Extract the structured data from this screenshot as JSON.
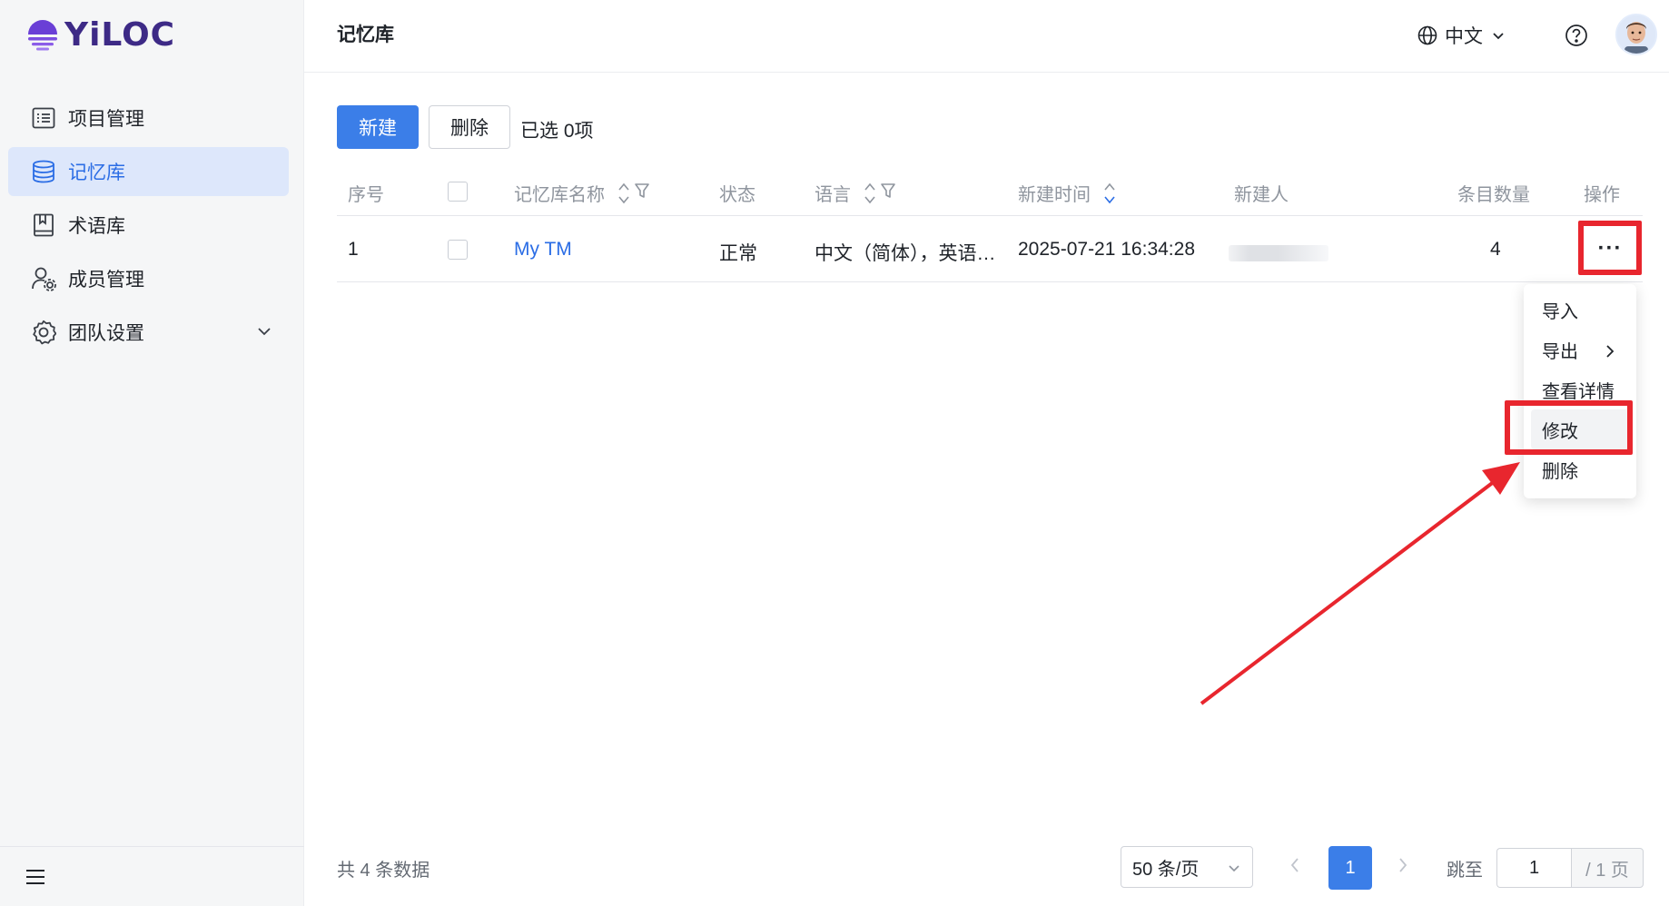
{
  "app": {
    "brand": "YiLOC"
  },
  "sidebar": {
    "items": [
      {
        "label": "项目管理",
        "icon": "project-list-icon"
      },
      {
        "label": "记忆库",
        "icon": "database-icon",
        "active": true
      },
      {
        "label": "术语库",
        "icon": "book-icon"
      },
      {
        "label": "成员管理",
        "icon": "member-settings-icon"
      },
      {
        "label": "团队设置",
        "icon": "gear-icon",
        "expandable": true
      }
    ]
  },
  "header": {
    "title": "记忆库",
    "language": "中文"
  },
  "toolbar": {
    "new_label": "新建",
    "delete_label": "删除",
    "selected_text": "已选 0项"
  },
  "table": {
    "columns": [
      "序号",
      "",
      "记忆库名称",
      "状态",
      "语言",
      "新建时间",
      "新建人",
      "条目数量",
      "操作"
    ],
    "rows": [
      {
        "index": "1",
        "name": "My TM",
        "status": "正常",
        "language": "中文（简体），英语…",
        "created_at": "2025-07-21 16:34:28",
        "count": "4",
        "actions": "···"
      }
    ]
  },
  "action_menu": {
    "items": [
      "导入",
      "导出",
      "查看详情",
      "修改",
      "删除"
    ]
  },
  "footer": {
    "total_text": "共 4 条数据",
    "page_size": "50 条/页",
    "current_page": "1",
    "jump_label": "跳至",
    "jump_value": "1",
    "page_total": "/ 1 页"
  },
  "colors": {
    "primary": "#3b7ee8",
    "active_nav_bg": "#dde7fb",
    "annotation": "#e8262e",
    "brand": "#3d2a86"
  }
}
